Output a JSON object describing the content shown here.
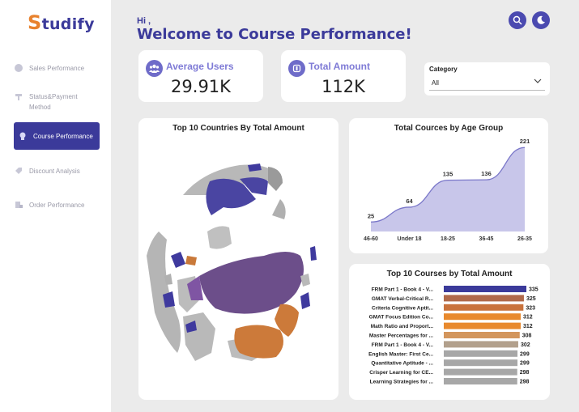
{
  "app": {
    "logo_initial": "S",
    "logo_rest": "tudify"
  },
  "sidebar": {
    "items": [
      {
        "label": "Sales Performance",
        "icon": "sales-icon",
        "active": false
      },
      {
        "label": "Status&Payment Method",
        "icon": "payment-icon",
        "active": false
      },
      {
        "label": "Course Performance",
        "icon": "course-icon",
        "active": true
      },
      {
        "label": "Discount Analysis",
        "icon": "discount-icon",
        "active": false
      },
      {
        "label": "Order Performance",
        "icon": "order-icon",
        "active": false
      }
    ]
  },
  "header": {
    "greeting": "Hi ,",
    "title": "Welcome to Course Performance!"
  },
  "kpis": {
    "users": {
      "label": "Average Users",
      "value": "29.91K",
      "icon": "users-icon"
    },
    "amount": {
      "label": "Total Amount",
      "value": "112K",
      "icon": "dollar-icon"
    }
  },
  "filter": {
    "label": "Category",
    "value": "All"
  },
  "map": {
    "title": "Top 10 Countries By Total Amount"
  },
  "colors": {
    "primary": "#3b3a9a",
    "accent_orange": "#e8822e",
    "area_fill": "#c8c6ea",
    "area_line": "#7a77c9"
  },
  "chart_data": [
    {
      "type": "area",
      "title": "Total Cources by Age Group",
      "categories": [
        "46-60",
        "Under 18",
        "18-25",
        "36-45",
        "26-35"
      ],
      "values": [
        25,
        64,
        135,
        136,
        221
      ],
      "ylim": [
        0,
        230
      ]
    },
    {
      "type": "bar",
      "orientation": "horizontal",
      "title": "Top 10 Courses by Total Amount",
      "categories": [
        "FRM Part 1 - Book 4 - V...",
        "GMAT Verbal-Critical R...",
        "Criteria Cognitive Aptit...",
        "GMAT Focus Edition Co...",
        "Math Ratio and Proport...",
        "Master Percentages for ...",
        "FRM Part 1 - Book 4 - V...",
        "English Master: First Ce...",
        "Quantitative Aptitude - ...",
        "Crisper Learning for CE...",
        "Learning Strategies for ..."
      ],
      "values": [
        335,
        325,
        323,
        312,
        312,
        308,
        302,
        299,
        299,
        298,
        298
      ],
      "colors": [
        "#3b3a9a",
        "#b0694a",
        "#c9723c",
        "#e8892d",
        "#e8892d",
        "#d3965d",
        "#b2a08c",
        "#a7a7a7",
        "#a7a7a7",
        "#a7a7a7",
        "#a7a7a7"
      ]
    }
  ]
}
